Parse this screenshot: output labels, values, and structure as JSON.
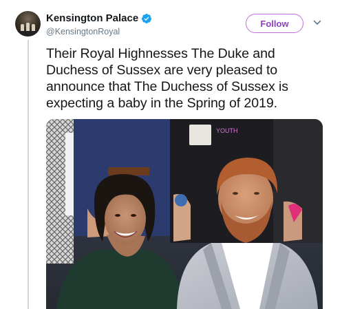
{
  "account": {
    "name": "Kensington Palace",
    "handle": "@KensingtonRoyal",
    "verified": true
  },
  "follow_label": "Follow",
  "tweet_text": "Their Royal Highnesses The Duke and\nDuchess of Sussex are very pleased to\nannounce that The Duchess of Sussex is\nexpecting a baby in the Spring of 2019.",
  "photo": {
    "sign_text": "YOUTH"
  },
  "colors": {
    "accent": "#8e3fbf",
    "follow_border": "#c26ce0",
    "verified_blue": "#1da1f2",
    "secondary_text": "#657786",
    "thread_line": "#ccd6dd"
  }
}
